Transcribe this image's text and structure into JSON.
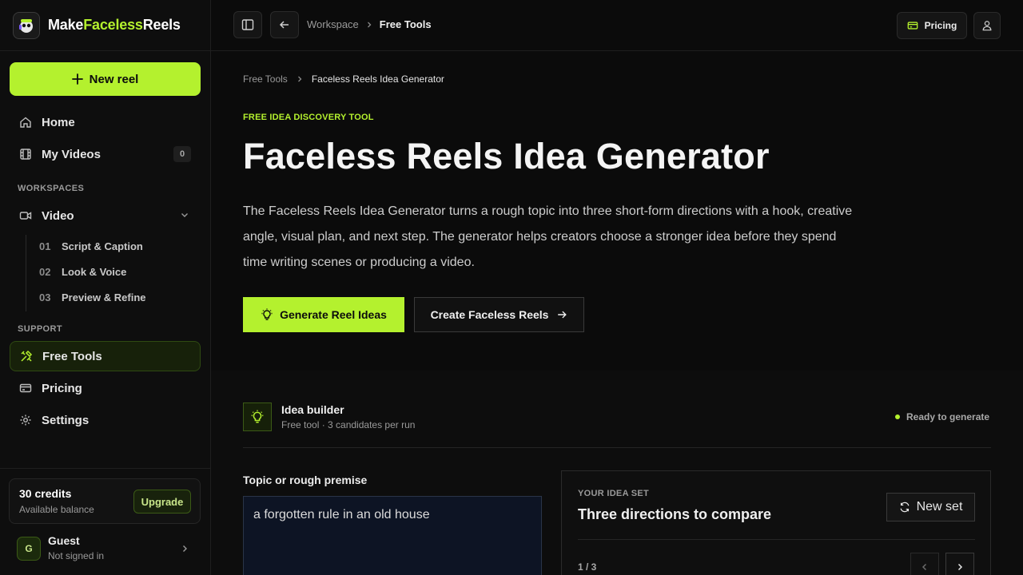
{
  "brand": {
    "name_part1": "Make",
    "name_accent": "Faceless",
    "name_part2": "Reels"
  },
  "sidebar": {
    "new_reel_label": "New reel",
    "home_label": "Home",
    "my_videos_label": "My Videos",
    "my_videos_count": "0",
    "workspaces_label": "WORKSPACES",
    "video_label": "Video",
    "video_steps": [
      {
        "num": "01",
        "label": "Script & Caption"
      },
      {
        "num": "02",
        "label": "Look & Voice"
      },
      {
        "num": "03",
        "label": "Preview & Refine"
      }
    ],
    "support_label": "SUPPORT",
    "free_tools_label": "Free Tools",
    "pricing_label": "Pricing",
    "settings_label": "Settings",
    "credits": {
      "title": "30 credits",
      "sub": "Available balance",
      "upgrade_label": "Upgrade"
    },
    "user": {
      "initial": "G",
      "name": "Guest",
      "status": "Not signed in"
    }
  },
  "topbar": {
    "breadcrumb": [
      "Workspace",
      "Free Tools"
    ],
    "pricing_label": "Pricing"
  },
  "main": {
    "breadcrumb": [
      "Free Tools",
      "Faceless Reels Idea Generator"
    ],
    "eyebrow": "FREE IDEA DISCOVERY TOOL",
    "title": "Faceless Reels Idea Generator",
    "description": "The Faceless Reels Idea Generator turns a rough topic into three short-form directions with a hook, creative angle, visual plan, and next step. The generator helps creators choose a stronger idea before they spend time writing scenes or producing a video.",
    "primary_cta": "Generate Reel Ideas",
    "secondary_cta": "Create Faceless Reels",
    "idea_builder": {
      "title": "Idea builder",
      "subtitle": "Free tool · 3 candidates per run",
      "status": "Ready to generate"
    },
    "topic_field": {
      "label": "Topic or rough premise",
      "value": "a forgotten rule in an old house"
    },
    "idea_set": {
      "eyebrow": "YOUR IDEA SET",
      "title": "Three directions to compare",
      "new_set_label": "New set",
      "pager": "1 / 3"
    }
  },
  "colors": {
    "accent": "#b4f12e",
    "background": "#0b0b0b",
    "sidebar_bg": "#0e0e0e"
  }
}
